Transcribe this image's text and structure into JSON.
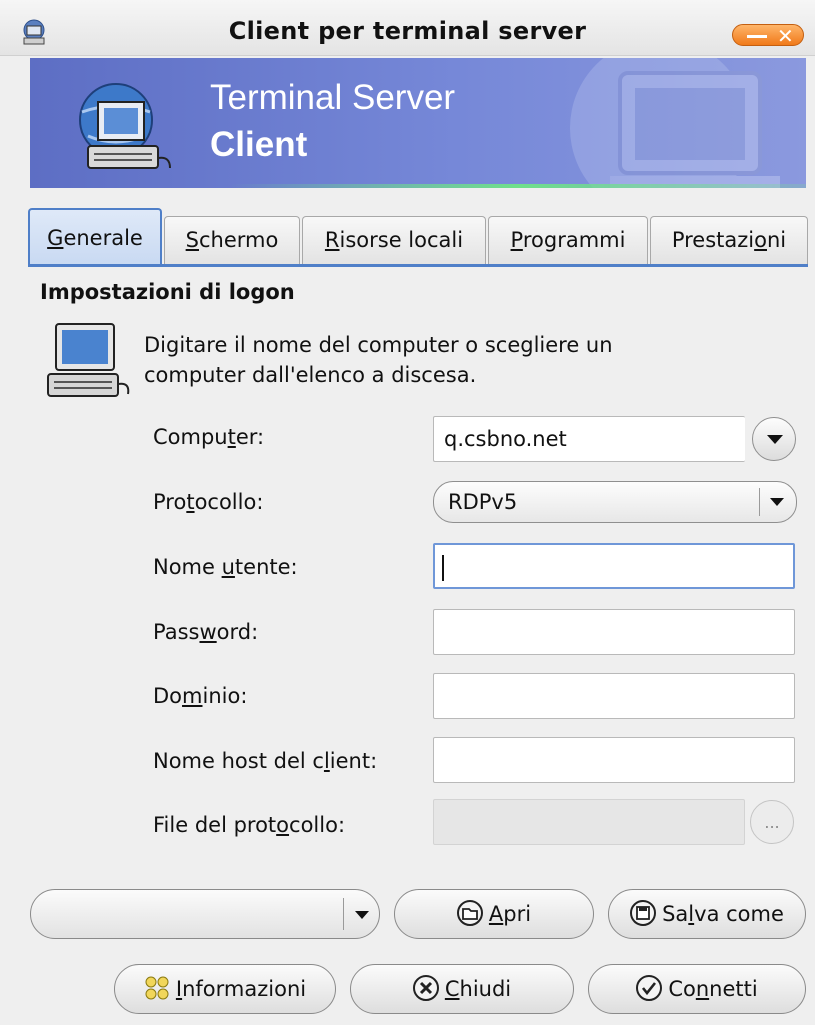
{
  "window": {
    "title": "Client per terminal server"
  },
  "banner": {
    "line1": "Terminal Server",
    "line2": "Client"
  },
  "tabs": [
    {
      "pre": "",
      "key": "G",
      "post": "enerale",
      "active": true
    },
    {
      "pre": "",
      "key": "S",
      "post": "chermo"
    },
    {
      "pre": "",
      "key": "R",
      "post": "isorse locali"
    },
    {
      "pre": "",
      "key": "P",
      "post": "rogrammi"
    },
    {
      "pre": "Prestazi",
      "key": "o",
      "post": "ni"
    }
  ],
  "logon": {
    "title": "Impostazioni di logon",
    "description_line1": "Digitare il nome del computer o scegliere un",
    "description_line2": "computer dall'elenco a discesa."
  },
  "form": {
    "computer": {
      "pre": "Compu",
      "key": "t",
      "post": "er:",
      "value": "q.csbno.net"
    },
    "protocol": {
      "pre": "Pro",
      "key": "t",
      "post": "ocollo:",
      "value": "RDPv5"
    },
    "username": {
      "pre": "Nome ",
      "key": "u",
      "post": "tente:",
      "value": ""
    },
    "password": {
      "pre": "Pass",
      "key": "w",
      "post": "ord:",
      "value": ""
    },
    "domain": {
      "pre": "Do",
      "key": "m",
      "post": "inio:",
      "value": ""
    },
    "client_host": {
      "pre": "Nome host del c",
      "key": "l",
      "post": "ient:",
      "value": ""
    },
    "protocol_file": {
      "pre": "File del prot",
      "key": "o",
      "post": "collo:",
      "value": "",
      "browse_label": "..."
    }
  },
  "actions": {
    "open": {
      "pre": "",
      "key": "A",
      "post": "pri"
    },
    "save_as": {
      "pre": "Sa",
      "key": "l",
      "post": "va come"
    },
    "info": {
      "pre": "",
      "key": "I",
      "post": "nformazioni"
    },
    "close": {
      "pre": "",
      "key": "C",
      "post": "hiudi"
    },
    "connect": {
      "pre": "Co",
      "key": "n",
      "post": "netti"
    }
  }
}
